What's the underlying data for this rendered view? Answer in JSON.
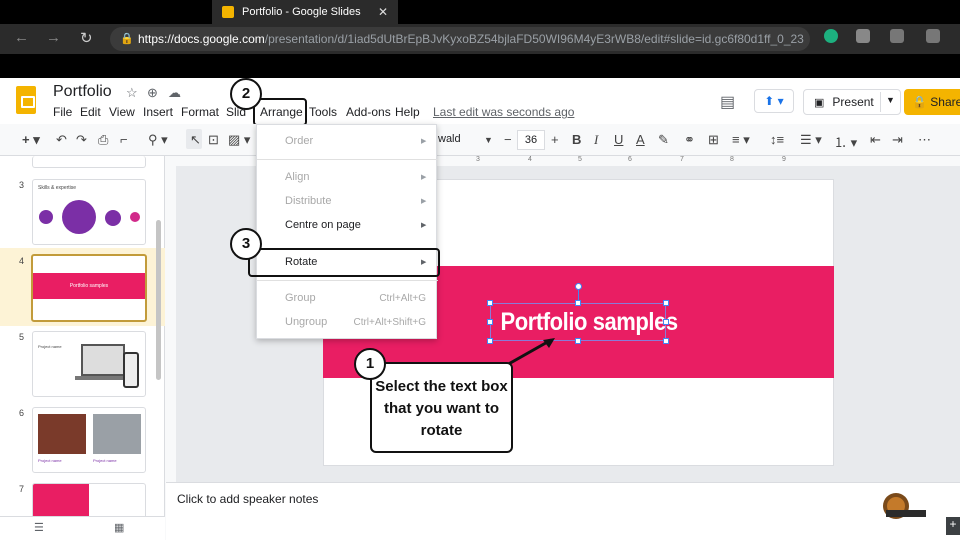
{
  "browser": {
    "tab_title": "Portfolio - Google Slides",
    "tab_close": "✕",
    "url_host": "https://docs.google.com",
    "url_path": "/presentation/d/1iad5dUtBrEpBJvKyxoBZ54bjlaFD50WI96M4yE3rWB8/edit#slide=id.gc6f80d1ff_0_23"
  },
  "app": {
    "title": "Portfolio",
    "menu": [
      "File",
      "Edit",
      "View",
      "Insert",
      "Format",
      "Slide",
      "Arrange",
      "Tools",
      "Add-ons",
      "Help"
    ],
    "menu_slide_partial": "Slid",
    "last_edit": "Last edit was seconds ago",
    "present": "Present",
    "share": "Share"
  },
  "toolbar": {
    "font": "wald",
    "font_size": "36"
  },
  "ruler": [
    "3",
    "4",
    "5",
    "6",
    "7",
    "8",
    "9"
  ],
  "filmstrip": {
    "slides": [
      {
        "num": "3",
        "label": "Skills & expertise"
      },
      {
        "num": "4",
        "label": "Portfolio samples"
      },
      {
        "num": "5",
        "label": "Project name"
      },
      {
        "num": "6",
        "label": "Project name"
      },
      {
        "num": "7",
        "label": ""
      }
    ]
  },
  "slide": {
    "title": "Portfolio samples",
    "band_color": "#e91e63"
  },
  "notes": {
    "placeholder": "Click to add speaker notes"
  },
  "arrange_menu": {
    "items": [
      {
        "label": "Order",
        "enabled": false,
        "submenu": true
      },
      {
        "label": "Align",
        "enabled": false,
        "submenu": true
      },
      {
        "label": "Distribute",
        "enabled": false,
        "submenu": true
      },
      {
        "label": "Centre on page",
        "enabled": true,
        "submenu": true
      },
      {
        "label": "Rotate",
        "enabled": true,
        "submenu": true
      },
      {
        "label": "Group",
        "enabled": false,
        "shortcut": "Ctrl+Alt+G"
      },
      {
        "label": "Ungroup",
        "enabled": false,
        "shortcut": "Ctrl+Alt+Shift+G"
      }
    ]
  },
  "annotations": {
    "step1": "1",
    "step2": "2",
    "step3": "3",
    "callout": "Select the text box that you want to rotate"
  },
  "colors": {
    "accent_yellow": "#f4b400",
    "pink": "#e91e63",
    "purple": "#7b2fa6"
  }
}
